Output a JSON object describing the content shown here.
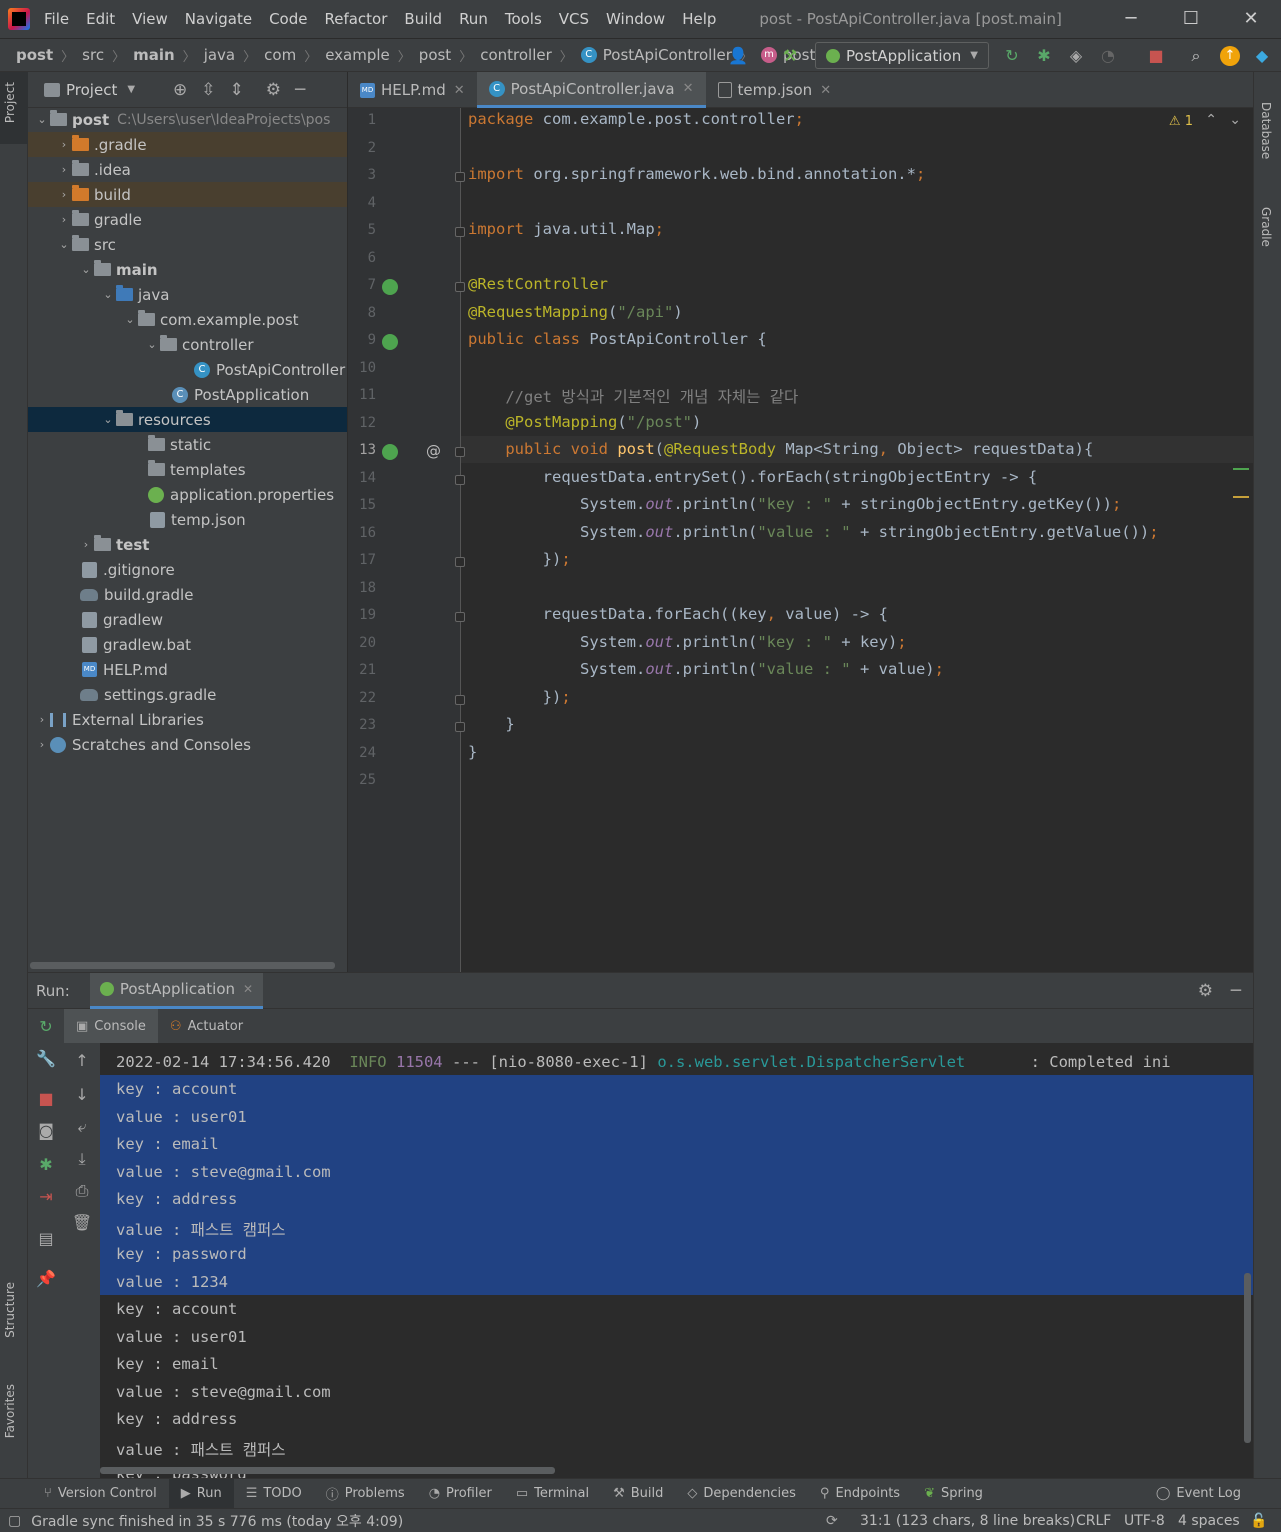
{
  "window": {
    "menus": [
      "File",
      "Edit",
      "View",
      "Navigate",
      "Code",
      "Refactor",
      "Build",
      "Run",
      "Tools",
      "VCS",
      "Window",
      "Help"
    ],
    "title": "post - PostApiController.java [post.main]"
  },
  "breadcrumb": [
    "post",
    "src",
    "main",
    "java",
    "com",
    "example",
    "post",
    "controller",
    "PostApiController",
    "post"
  ],
  "run_config": "PostApplication",
  "side_tabs": {
    "left_top": "Project",
    "left_mid": "Structure",
    "left_bottom": "Favorites",
    "right_top": "Database",
    "right_mid": "Gradle"
  },
  "project": {
    "header": "Project",
    "root_name": "post",
    "root_path": "C:\\Users\\user\\IdeaProjects\\pos",
    "items": [
      ".gradle",
      ".idea",
      "build",
      "gradle",
      "src",
      "main",
      "java",
      "com.example.post",
      "controller",
      "PostApiController",
      "PostApplication",
      "resources",
      "static",
      "templates",
      "application.properties",
      "temp.json",
      "test",
      ".gitignore",
      "build.gradle",
      "gradlew",
      "gradlew.bat",
      "HELP.md",
      "settings.gradle",
      "External Libraries",
      "Scratches and Consoles"
    ]
  },
  "tabs": [
    "HELP.md",
    "PostApiController.java",
    "temp.json"
  ],
  "editor": {
    "warning_count": "1",
    "lines": [
      "package com.example.post.controller;",
      "",
      "import org.springframework.web.bind.annotation.*;",
      "",
      "import java.util.Map;",
      "",
      "@RestController",
      "@RequestMapping(\"/api\")",
      "public class PostApiController {",
      "",
      "    //get 방식과 기본적인 개념 자체는 같다",
      "    @PostMapping(\"/post\")",
      "    public void post(@RequestBody Map<String, Object> requestData){",
      "        requestData.entrySet().forEach(stringObjectEntry -> {",
      "            System.out.println(\"key : \" + stringObjectEntry.getKey());",
      "            System.out.println(\"value : \" + stringObjectEntry.getValue());",
      "        });",
      "",
      "        requestData.forEach((key, value) -> {",
      "            System.out.println(\"key : \" + key);",
      "            System.out.println(\"value : \" + value);",
      "        });",
      "    }",
      "}",
      ""
    ],
    "current_line": 13
  },
  "run": {
    "label": "Run:",
    "tab": "PostApplication",
    "subtabs": [
      "Console",
      "Actuator"
    ],
    "log_head": {
      "timestamp": "2022-02-14 17:34:56.420",
      "level": "INFO",
      "pid": "11504",
      "sep": " --- ",
      "thread": "[nio-8080-exec-1]",
      "logger": "o.s.web.servlet.DispatcherServlet",
      "msg": "       : Completed ini"
    },
    "output": [
      "key : account",
      "value : user01",
      "key : email",
      "value : steve@gmail.com",
      "key : address",
      "value : 패스트 캠퍼스",
      "key : password",
      "value : 1234",
      "key : account",
      "value : user01",
      "key : email",
      "value : steve@gmail.com",
      "key : address",
      "value : 패스트 캠퍼스",
      "key : password"
    ]
  },
  "bottom_tabs": [
    "Version Control",
    "Run",
    "TODO",
    "Problems",
    "Profiler",
    "Terminal",
    "Build",
    "Dependencies",
    "Endpoints",
    "Spring",
    "Event Log"
  ],
  "status": {
    "message": "Gradle sync finished in 35 s 776 ms (today 오후 4:09)",
    "position": "31:1 (123 chars, 8 line breaks)",
    "line_sep": "CRLF",
    "encoding": "UTF-8",
    "indent": "4 spaces"
  }
}
